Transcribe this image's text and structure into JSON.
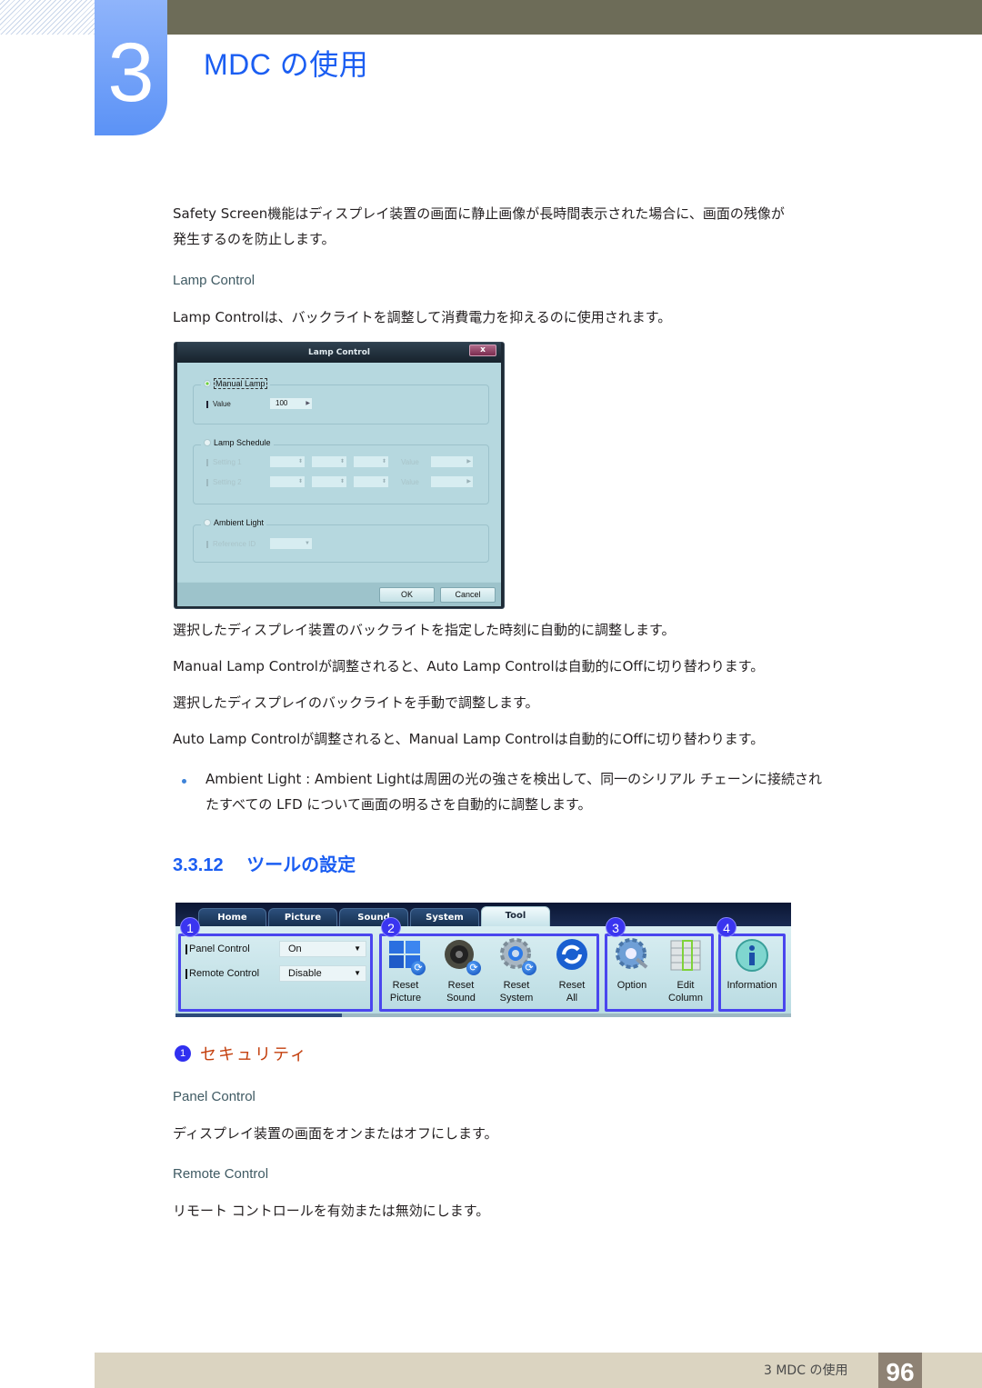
{
  "header": {
    "chapter_number": "3",
    "chapter_title": "MDC の使用"
  },
  "intro": {
    "safety_screen_line1": "Safety Screen機能はディスプレイ装置の画面に静止画像が長時間表示された場合に、画面の残像が",
    "safety_screen_line2": "発生するのを防止します。",
    "lamp_control_heading": "Lamp Control",
    "lamp_control_desc": "Lamp Controlは、バックライトを調整して消費電力を抑えるのに使用されます。"
  },
  "lamp_dialog": {
    "title": "Lamp Control",
    "close_label": "x",
    "manual_lamp": {
      "label": "Manual Lamp",
      "selected": true,
      "value_label": "Value",
      "value": "100"
    },
    "lamp_schedule": {
      "label": "Lamp Schedule",
      "selected": false,
      "setting1_label": "Setting 1",
      "setting2_label": "Setting 2",
      "value_label": "Value"
    },
    "ambient_light": {
      "label": "Ambient Light",
      "selected": false,
      "reference_id_label": "Reference ID"
    },
    "ok_label": "OK",
    "cancel_label": "Cancel"
  },
  "body": {
    "p1": "選択したディスプレイ装置のバックライトを指定した時刻に自動的に調整します。",
    "p2": "Manual Lamp Controlが調整されると、Auto Lamp Controlは自動的にOffに切り替わります。",
    "p3": "選択したディスプレイのバックライトを手動で調整します。",
    "p4": "Auto Lamp Controlが調整されると、Manual Lamp Controlは自動的にOffに切り替わります。",
    "bullet_line1": "Ambient Light : Ambient Lightは周囲の光の強さを検出して、同一のシリアル チェーンに接続され",
    "bullet_line2": "たすべての LFD について画面の明るさを自動的に調整します。"
  },
  "section": {
    "number": "3.3.12",
    "title": "ツールの設定"
  },
  "tool_panel": {
    "tabs": [
      {
        "label": "Home",
        "active": false
      },
      {
        "label": "Picture",
        "active": false
      },
      {
        "label": "Sound",
        "active": false
      },
      {
        "label": "System",
        "active": false
      },
      {
        "label": "Tool",
        "active": true
      }
    ],
    "badges": [
      "1",
      "2",
      "3",
      "4"
    ],
    "panel_control": {
      "label": "Panel Control",
      "value": "On"
    },
    "remote_control": {
      "label": "Remote Control",
      "value": "Disable"
    },
    "buttons": [
      {
        "line1": "Reset",
        "line2": "Picture",
        "icon": "reset-picture-icon"
      },
      {
        "line1": "Reset",
        "line2": "Sound",
        "icon": "reset-sound-icon"
      },
      {
        "line1": "Reset",
        "line2": "System",
        "icon": "reset-system-icon"
      },
      {
        "line1": "Reset",
        "line2": "All",
        "icon": "reset-all-icon"
      },
      {
        "line1": "Option",
        "line2": "",
        "icon": "option-icon"
      },
      {
        "line1": "Edit",
        "line2": "Column",
        "icon": "edit-column-icon"
      },
      {
        "line1": "Information",
        "line2": "",
        "icon": "information-icon"
      }
    ]
  },
  "security": {
    "number": "1",
    "title": "セキュリティ",
    "panel_control_heading": "Panel Control",
    "panel_control_desc": "ディスプレイ装置の画面をオンまたはオフにします。",
    "remote_control_heading": "Remote Control",
    "remote_control_desc": "リモート コントロールを有効または無効にします。"
  },
  "footer": {
    "chapter_label": "3 MDC の使用",
    "page_number": "96"
  }
}
